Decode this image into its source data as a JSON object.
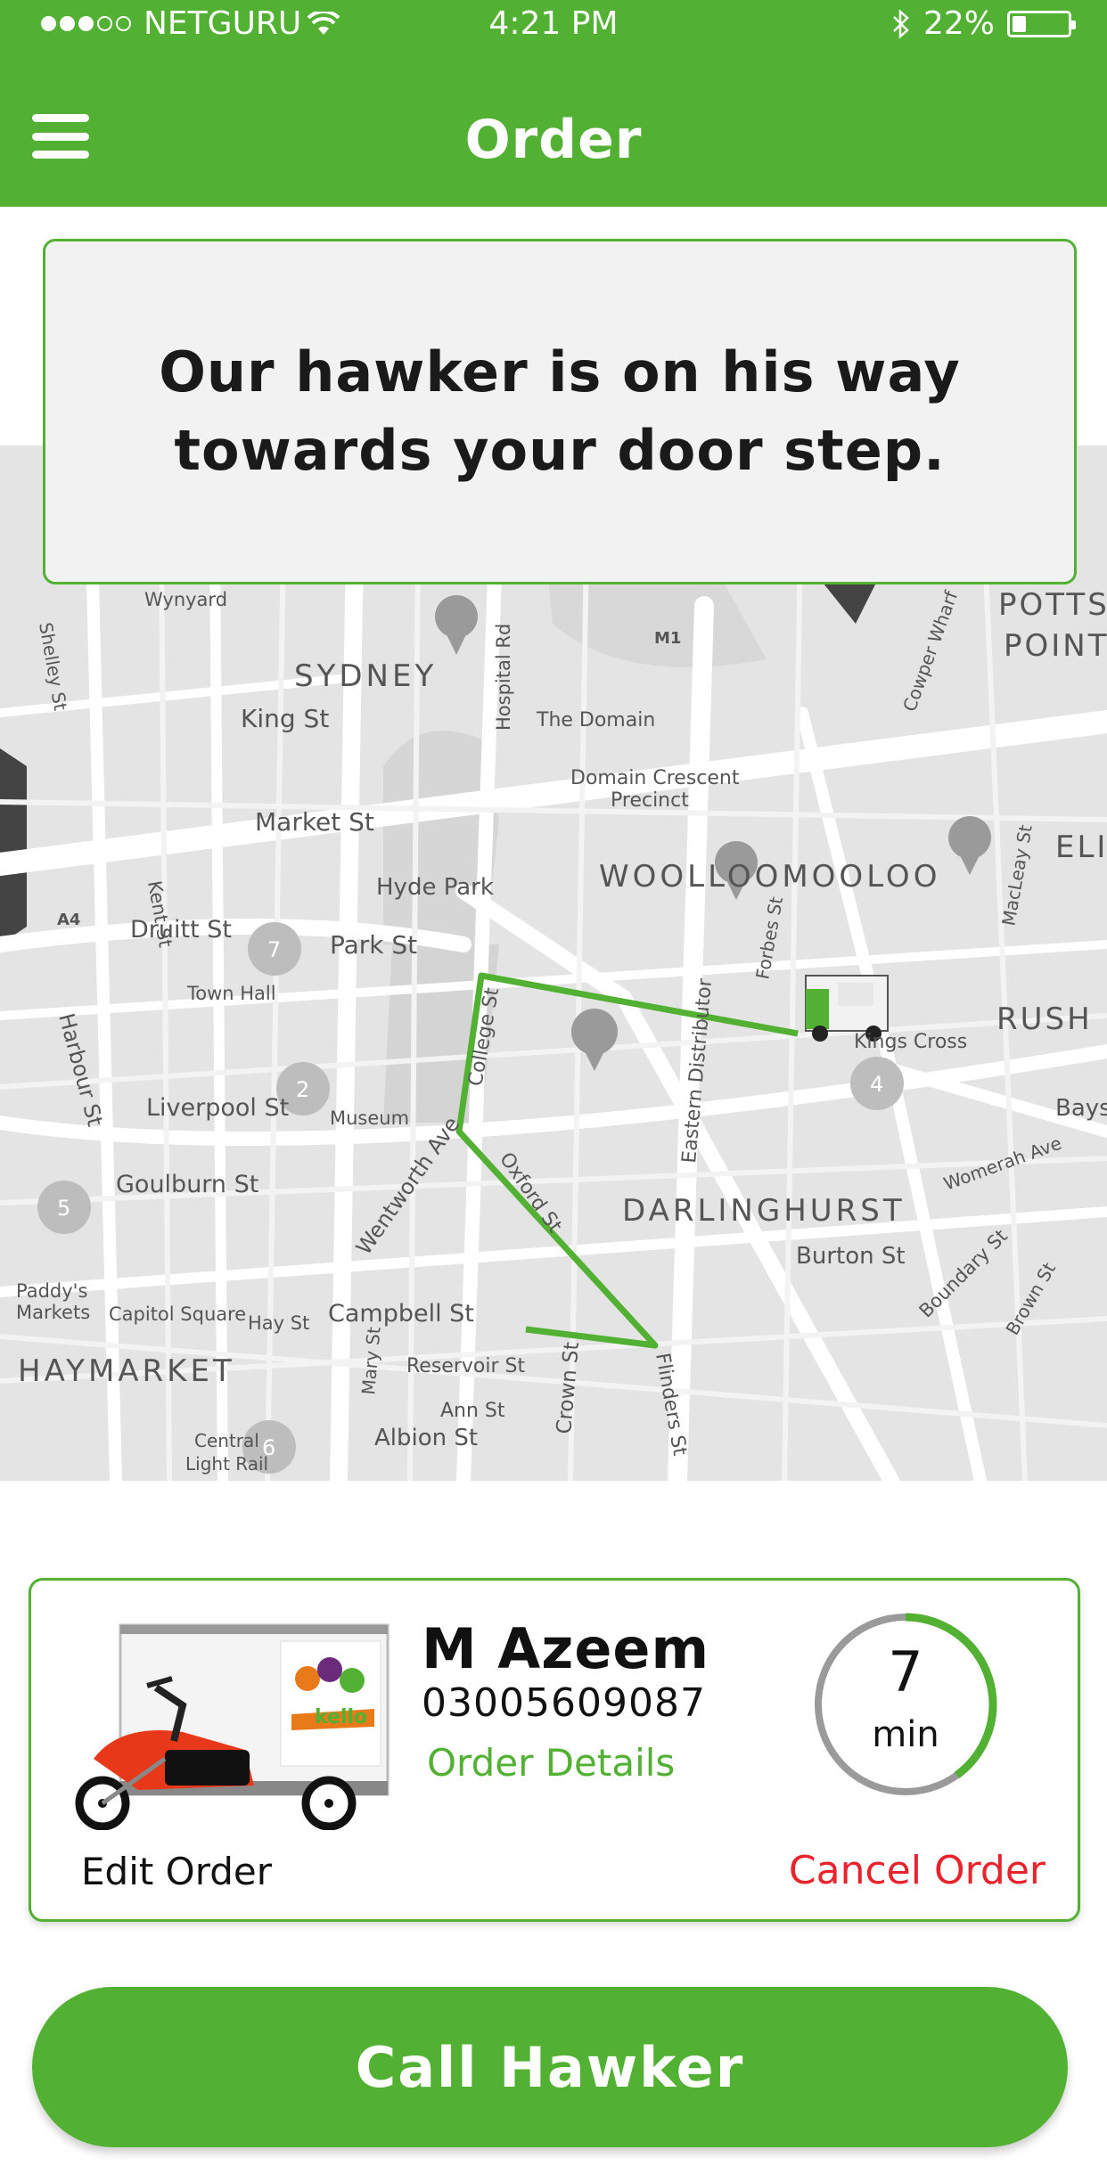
{
  "status_bar": {
    "carrier": "NETGURU",
    "time": "4:21 PM",
    "battery": "22%",
    "battery_level": 0.22
  },
  "header": {
    "title": "Order",
    "menu_icon": "hamburger-menu-icon"
  },
  "message": {
    "text": "Our hawker is on his way towards your door step."
  },
  "map": {
    "labels": [
      {
        "text": "SYDNEY"
      },
      {
        "text": "POTTS"
      },
      {
        "text": "POINT"
      },
      {
        "text": "King St"
      },
      {
        "text": "Market St"
      },
      {
        "text": "Hyde Park"
      },
      {
        "text": "The Domain"
      },
      {
        "text": "Domain Crescent"
      },
      {
        "text": "Precinct"
      },
      {
        "text": "WOOLLOOMOOLOO"
      },
      {
        "text": "Druitt St"
      },
      {
        "text": "Park St"
      },
      {
        "text": "Town Hall"
      },
      {
        "text": "Liverpool St"
      },
      {
        "text": "Museum"
      },
      {
        "text": "Goulburn St"
      },
      {
        "text": "DARLINGHURST"
      },
      {
        "text": "Kings Cross"
      },
      {
        "text": "Burton St"
      },
      {
        "text": "Campbell St"
      },
      {
        "text": "Capitol Square"
      },
      {
        "text": "Paddy's"
      },
      {
        "text": "Markets"
      },
      {
        "text": "HAYMARKET"
      },
      {
        "text": "Reservoir St"
      },
      {
        "text": "Ann St"
      },
      {
        "text": "Albion St"
      },
      {
        "text": "Wynyard"
      },
      {
        "text": "Kent St"
      },
      {
        "text": "Harbour St"
      },
      {
        "text": "Hospital Rd"
      },
      {
        "text": "College St"
      },
      {
        "text": "Oxford St"
      },
      {
        "text": "Forbes St"
      },
      {
        "text": "Eastern Distributor"
      },
      {
        "text": "Wentworth Ave"
      },
      {
        "text": "Crown St"
      },
      {
        "text": "Flinders St"
      },
      {
        "text": "Boundary St"
      },
      {
        "text": "Womerah Ave"
      },
      {
        "text": "Brown St"
      },
      {
        "text": "MacLeay St"
      },
      {
        "text": "Cowper Wharf"
      },
      {
        "text": "Hay St"
      },
      {
        "text": "Mary St"
      },
      {
        "text": "Central"
      },
      {
        "text": "Light Rail"
      },
      {
        "text": "Shelley St"
      },
      {
        "text": "RUSH"
      },
      {
        "text": "Bays"
      },
      {
        "text": "ELI"
      },
      {
        "text": "M1"
      },
      {
        "text": "A4"
      },
      {
        "text": "7"
      },
      {
        "text": "2"
      },
      {
        "text": "5"
      },
      {
        "text": "4"
      },
      {
        "text": "6"
      }
    ],
    "route_color": "#52b032"
  },
  "order": {
    "hawker_name": "M Azeem",
    "phone": "03005609087",
    "details_label": "Order Details",
    "edit_label": "Edit Order",
    "cancel_label": "Cancel Order",
    "eta_value": "7",
    "eta_unit": "min",
    "eta_progress": 0.4,
    "truck_brand": "kello"
  },
  "call_button": {
    "label": "Call Hawker"
  },
  "colors": {
    "brand_green": "#52b032",
    "cancel_red": "#e8232c"
  }
}
